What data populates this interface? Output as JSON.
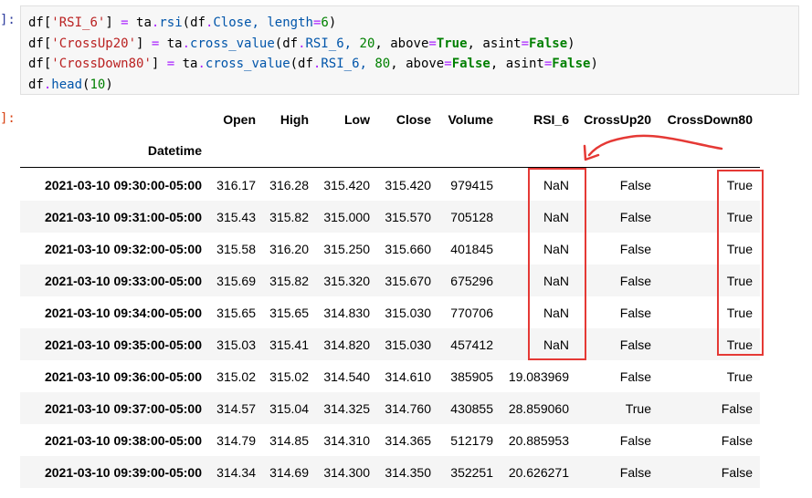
{
  "prompts": {
    "input": "]:",
    "output": "]:"
  },
  "code": {
    "line1": [
      {
        "t": "df[",
        "c": ""
      },
      {
        "t": "'RSI_6'",
        "c": "s"
      },
      {
        "t": "] ",
        "c": ""
      },
      {
        "t": "=",
        "c": "o"
      },
      {
        "t": " ta",
        "c": ""
      },
      {
        "t": ".",
        "c": "o"
      },
      {
        "t": "rsi",
        "c": "f"
      },
      {
        "t": "(df",
        "c": ""
      },
      {
        "t": ".",
        "c": "o"
      },
      {
        "t": "Close, length",
        "c": "f"
      },
      {
        "t": "=",
        "c": "o"
      },
      {
        "t": "6",
        "c": "n"
      },
      {
        "t": ")",
        "c": ""
      }
    ],
    "line2": [
      {
        "t": "df[",
        "c": ""
      },
      {
        "t": "'CrossUp20'",
        "c": "s"
      },
      {
        "t": "] ",
        "c": ""
      },
      {
        "t": "=",
        "c": "o"
      },
      {
        "t": " ta",
        "c": ""
      },
      {
        "t": ".",
        "c": "o"
      },
      {
        "t": "cross_value",
        "c": "f"
      },
      {
        "t": "(df",
        "c": ""
      },
      {
        "t": ".",
        "c": "o"
      },
      {
        "t": "RSI_6, ",
        "c": "f"
      },
      {
        "t": "20",
        "c": "n"
      },
      {
        "t": ", above",
        "c": ""
      },
      {
        "t": "=",
        "c": "o"
      },
      {
        "t": "True",
        "c": "k"
      },
      {
        "t": ", asint",
        "c": ""
      },
      {
        "t": "=",
        "c": "o"
      },
      {
        "t": "False",
        "c": "k"
      },
      {
        "t": ")",
        "c": ""
      }
    ],
    "line3": [
      {
        "t": "df[",
        "c": ""
      },
      {
        "t": "'CrossDown80'",
        "c": "s"
      },
      {
        "t": "] ",
        "c": ""
      },
      {
        "t": "=",
        "c": "o"
      },
      {
        "t": " ta",
        "c": ""
      },
      {
        "t": ".",
        "c": "o"
      },
      {
        "t": "cross_value",
        "c": "f"
      },
      {
        "t": "(df",
        "c": ""
      },
      {
        "t": ".",
        "c": "o"
      },
      {
        "t": "RSI_6, ",
        "c": "f"
      },
      {
        "t": "80",
        "c": "n"
      },
      {
        "t": ", above",
        "c": ""
      },
      {
        "t": "=",
        "c": "o"
      },
      {
        "t": "False",
        "c": "k"
      },
      {
        "t": ", asint",
        "c": ""
      },
      {
        "t": "=",
        "c": "o"
      },
      {
        "t": "False",
        "c": "k"
      },
      {
        "t": ")",
        "c": ""
      }
    ],
    "line4": [
      {
        "t": "df",
        "c": ""
      },
      {
        "t": ".",
        "c": "o"
      },
      {
        "t": "head",
        "c": "f"
      },
      {
        "t": "(",
        "c": ""
      },
      {
        "t": "10",
        "c": "n"
      },
      {
        "t": ")",
        "c": ""
      }
    ]
  },
  "table": {
    "columns": [
      "Open",
      "High",
      "Low",
      "Close",
      "Volume",
      "RSI_6",
      "CrossUp20",
      "CrossDown80"
    ],
    "index_name": "Datetime",
    "rows": [
      {
        "idx": "2021-03-10 09:30:00-05:00",
        "vals": [
          "316.17",
          "316.28",
          "315.420",
          "315.420",
          "979415",
          "NaN",
          "False",
          "True"
        ]
      },
      {
        "idx": "2021-03-10 09:31:00-05:00",
        "vals": [
          "315.43",
          "315.82",
          "315.000",
          "315.570",
          "705128",
          "NaN",
          "False",
          "True"
        ]
      },
      {
        "idx": "2021-03-10 09:32:00-05:00",
        "vals": [
          "315.58",
          "316.20",
          "315.250",
          "315.660",
          "401845",
          "NaN",
          "False",
          "True"
        ]
      },
      {
        "idx": "2021-03-10 09:33:00-05:00",
        "vals": [
          "315.69",
          "315.82",
          "315.320",
          "315.670",
          "675296",
          "NaN",
          "False",
          "True"
        ]
      },
      {
        "idx": "2021-03-10 09:34:00-05:00",
        "vals": [
          "315.65",
          "315.65",
          "314.830",
          "315.030",
          "770706",
          "NaN",
          "False",
          "True"
        ]
      },
      {
        "idx": "2021-03-10 09:35:00-05:00",
        "vals": [
          "315.03",
          "315.41",
          "314.820",
          "315.030",
          "457412",
          "NaN",
          "False",
          "True"
        ]
      },
      {
        "idx": "2021-03-10 09:36:00-05:00",
        "vals": [
          "315.02",
          "315.02",
          "314.540",
          "314.610",
          "385905",
          "19.083969",
          "False",
          "True"
        ]
      },
      {
        "idx": "2021-03-10 09:37:00-05:00",
        "vals": [
          "314.57",
          "315.04",
          "314.325",
          "314.760",
          "430855",
          "28.859060",
          "True",
          "False"
        ]
      },
      {
        "idx": "2021-03-10 09:38:00-05:00",
        "vals": [
          "314.79",
          "314.85",
          "314.310",
          "314.365",
          "512179",
          "20.885953",
          "False",
          "False"
        ]
      },
      {
        "idx": "2021-03-10 09:39:00-05:00",
        "vals": [
          "314.34",
          "314.69",
          "314.300",
          "314.350",
          "352251",
          "20.626271",
          "False",
          "False"
        ]
      }
    ]
  },
  "annotation_color": "#e53935"
}
